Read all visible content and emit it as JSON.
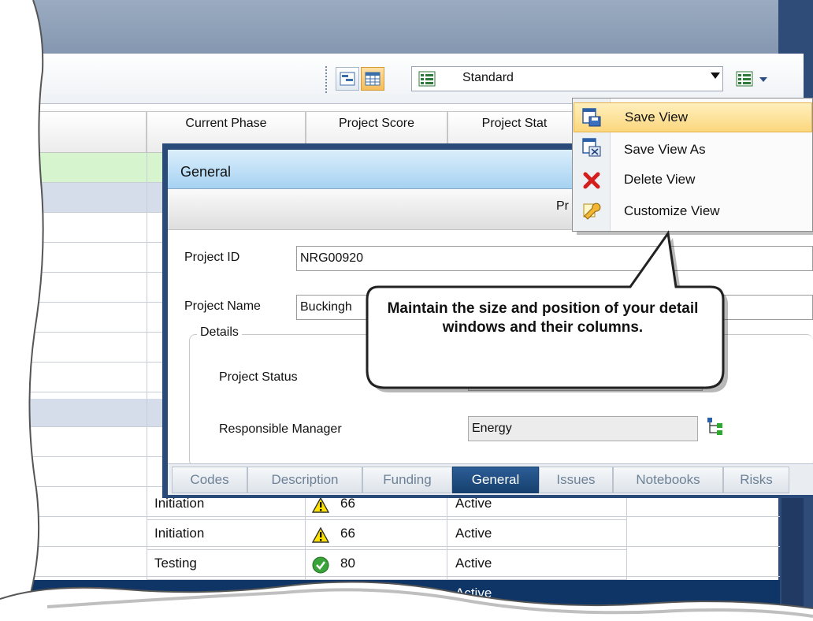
{
  "toolbar": {
    "view_select_value": "Standard"
  },
  "columns": [
    "Current Phase",
    "Project Score",
    "Project Stat"
  ],
  "menu": {
    "items": [
      {
        "label": "Save View",
        "icon": "save-view-icon"
      },
      {
        "label": "Save View As",
        "icon": "save-view-as-icon"
      },
      {
        "label": "Delete View",
        "icon": "delete-x-icon"
      },
      {
        "label": "Customize View",
        "icon": "wrench-icon"
      }
    ]
  },
  "detail": {
    "title": "General",
    "subbar_text": "Pr",
    "project_id_label": "Project ID",
    "project_id_value": "NRG00920",
    "project_name_label": "Project Name",
    "project_name_value": "Buckingh",
    "details_legend": "Details",
    "project_status_label": "Project Status",
    "responsible_manager_label": "Responsible Manager",
    "responsible_manager_value": "Energy",
    "tabs": [
      "Codes",
      "Description",
      "Funding",
      "General",
      "Issues",
      "Notebooks",
      "Risks"
    ],
    "selected_tab": "General"
  },
  "rows": [
    {
      "phase": "Initiation",
      "score": "66",
      "status": "Active",
      "icon": "warning-icon"
    },
    {
      "phase": "Initiation",
      "score": "66",
      "status": "Active",
      "icon": "warning-icon"
    },
    {
      "phase": "Testing",
      "score": "80",
      "status": "Active",
      "icon": "check-icon"
    },
    {
      "phase": "",
      "score": "",
      "status": "Active",
      "icon": ""
    }
  ],
  "callout": {
    "text": "Maintain the size and position of your detail windows and their columns."
  },
  "colors": {
    "frame_navy": "#2f4c79",
    "selection_navy": "#0e3566",
    "menu_highlight": "#fbd77d",
    "title_gradient": "#a6d2f2",
    "green_row": "#d6f5cf",
    "blue_row": "#d5dcea"
  }
}
